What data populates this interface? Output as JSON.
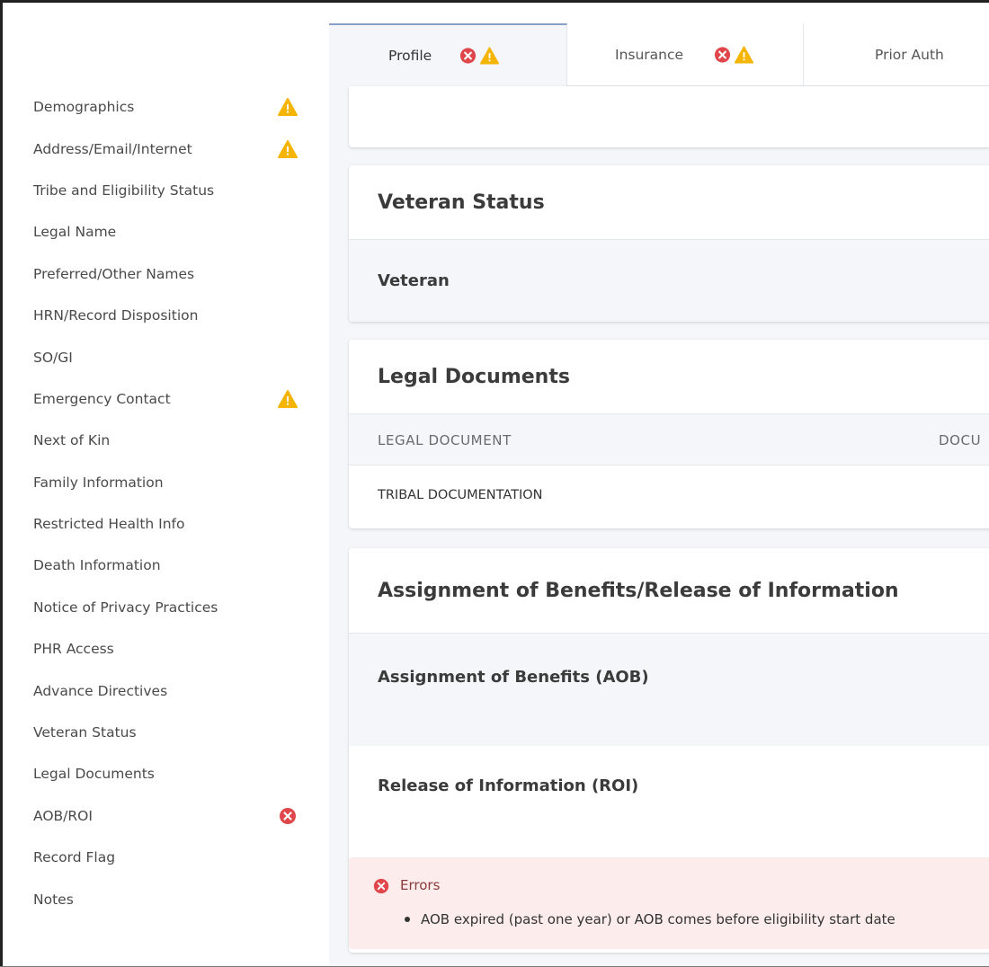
{
  "tabs": [
    {
      "label": "Profile",
      "icons": [
        "error-icon",
        "warning-icon"
      ]
    },
    {
      "label": "Insurance",
      "icons": [
        "error-icon",
        "warning-icon"
      ]
    },
    {
      "label": "Prior Auth",
      "icons": []
    }
  ],
  "sidebar": {
    "items": [
      {
        "label": "Demographics",
        "status": "warning"
      },
      {
        "label": "Address/Email/Internet",
        "status": "warning"
      },
      {
        "label": "Tribe and Eligibility Status",
        "status": ""
      },
      {
        "label": "Legal Name",
        "status": ""
      },
      {
        "label": "Preferred/Other Names",
        "status": ""
      },
      {
        "label": "HRN/Record Disposition",
        "status": ""
      },
      {
        "label": "SO/GI",
        "status": ""
      },
      {
        "label": "Emergency Contact",
        "status": "warning"
      },
      {
        "label": "Next of Kin",
        "status": ""
      },
      {
        "label": "Family Information",
        "status": ""
      },
      {
        "label": "Restricted Health Info",
        "status": ""
      },
      {
        "label": "Death Information",
        "status": ""
      },
      {
        "label": "Notice of Privacy Practices",
        "status": ""
      },
      {
        "label": "PHR Access",
        "status": ""
      },
      {
        "label": "Advance Directives",
        "status": ""
      },
      {
        "label": "Veteran Status",
        "status": ""
      },
      {
        "label": "Legal Documents",
        "status": ""
      },
      {
        "label": "AOB/ROI",
        "status": "error"
      },
      {
        "label": "Record Flag",
        "status": ""
      },
      {
        "label": "Notes",
        "status": ""
      }
    ]
  },
  "veteran": {
    "title": "Veteran Status",
    "row_label": "Veteran"
  },
  "legal": {
    "title": "Legal Documents",
    "col1": "LEGAL DOCUMENT",
    "col2": "DOCU",
    "row1": "TRIBAL DOCUMENTATION"
  },
  "aob": {
    "title": "Assignment of Benefits/Release of Information",
    "aob_label": "Assignment of Benefits (AOB)",
    "roi_label": "Release of Information (ROI)"
  },
  "errors": {
    "title": "Errors",
    "items": [
      "AOB expired (past one year) or AOB comes before eligibility start date"
    ]
  },
  "colors": {
    "warning": "#f5b400",
    "error": "#e0474c",
    "accent": "#8aa0c8"
  }
}
